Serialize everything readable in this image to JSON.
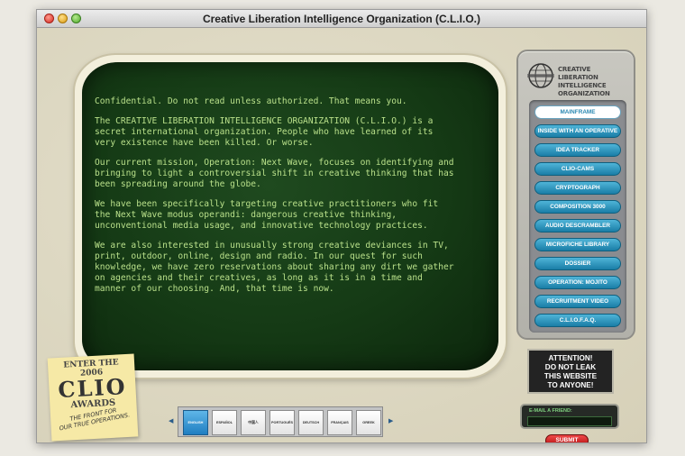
{
  "window": {
    "title": "Creative Liberation Intelligence Organization (C.L.I.O.)"
  },
  "screen": {
    "paragraphs": [
      "Confidential. Do not read unless authorized. That means you.",
      "The CREATIVE LIBERATION INTELLIGENCE ORGANIZATION (C.L.I.O.) is a\nsecret international organization. People who have learned of its\nvery existence have been killed. Or worse.",
      "Our current mission, Operation: Next Wave, focuses on identifying and\nbringing to light a controversial shift in creative thinking that has\nbeen spreading around the globe.",
      "We have been specifically targeting creative practitioners who fit\nthe Next Wave modus operandi: dangerous creative thinking,\nunconventional media usage, and innovative technology practices.",
      "We are also interested in unusually strong creative deviances in TV,\nprint, outdoor, online, design and radio. In our quest for such\nknowledge, we have zero reservations about sharing any dirt we gather\non agencies and their creatives, as long as it is in a time and\nmanner of our choosing. And, that time is now."
    ]
  },
  "panel": {
    "logo_line1": "CREATIVE LIBERATION",
    "logo_line2": "INTELLIGENCE ORGANIZATION",
    "nav": [
      "MAINFRAME",
      "INSIDE WITH AN OPERATIVE",
      "IDEA TRACKER",
      "CLIO-CAMS",
      "CRYPTOGRAPH",
      "COMPOSITION 3000",
      "AUDIO DESCRAMBLER",
      "MICROFICHE LIBRARY",
      "DOSSIER",
      "OPERATION: MOJITO",
      "RECRUITMENT VIDEO",
      "C.L.I.O.F.A.Q."
    ]
  },
  "attention": {
    "line1": "ATTENTION!",
    "line2": "DO NOT LEAK",
    "line3": "THIS WEBSITE",
    "line4": "TO ANYONE!"
  },
  "email": {
    "label": "E-MAIL A FRIEND:",
    "submit": "SUBMIT"
  },
  "sticky": {
    "line1": "ENTER THE",
    "line2": "2006",
    "line3": "CLIO",
    "line4": "AWARDS",
    "line5": "THE FRONT FOR\nOUR TRUE OPERATIONS."
  },
  "languages": [
    "ENGLISH",
    "ESPAÑOL",
    "中国人",
    "PORTUGUÊS",
    "DEUTSCH",
    "FRANÇAIS",
    "GREEK"
  ],
  "colors": {
    "screen_text": "#b9e08a",
    "nav_blue": "#1a7ea6",
    "submit_red": "#b10e0e"
  }
}
